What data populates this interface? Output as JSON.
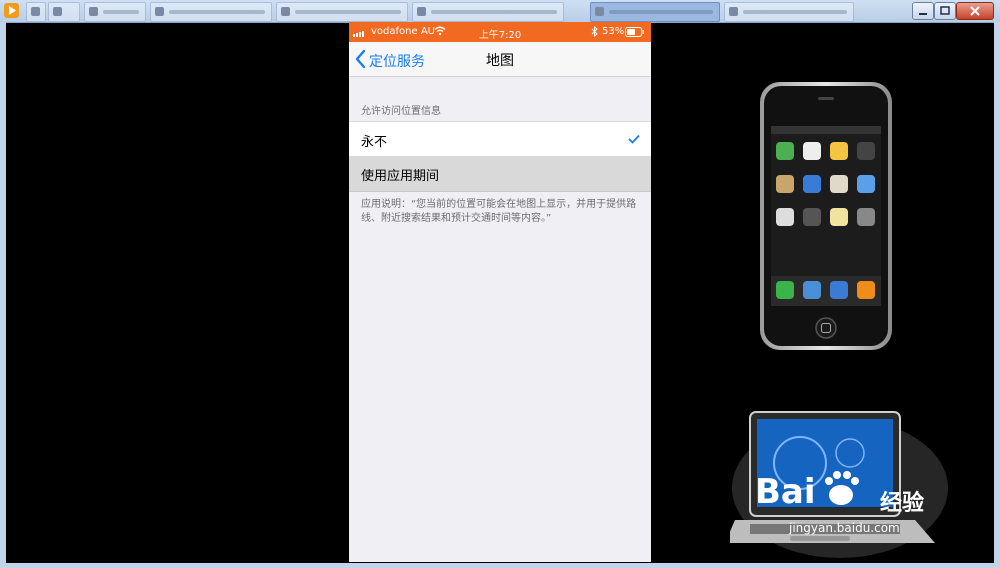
{
  "status_bar": {
    "carrier": "vodafone AU",
    "time": "上午7:20",
    "battery_percent": "53%"
  },
  "nav": {
    "back_label": "定位服务",
    "title": "地图"
  },
  "location_access": {
    "section_header": "允许访问位置信息",
    "options": [
      {
        "label": "永不",
        "selected": true
      },
      {
        "label": "使用应用期间",
        "selected": false
      }
    ],
    "footer_note": "应用说明：“您当前的位置可能会在地图上显示，并用于提供路线、附近搜索结果和预计交通时间等内容。”"
  },
  "watermark": {
    "brand": "经验",
    "url": "jingyan.baidu.com"
  },
  "colors": {
    "status_bar_bg": "#f26a21",
    "accent": "#1a7cf5",
    "page_bg": "#efeff4",
    "highlight_row": "#d9d9d9"
  },
  "icons": [
    "back-chevron-icon",
    "wifi-icon",
    "bluetooth-icon",
    "battery-icon",
    "checkmark-icon",
    "signal-bars-icon"
  ]
}
